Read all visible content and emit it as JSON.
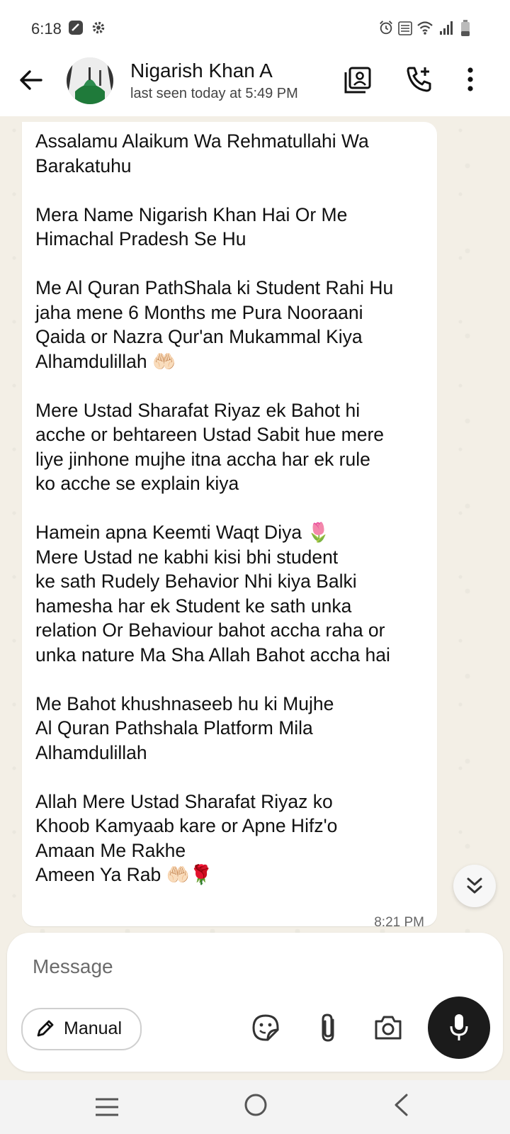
{
  "status_bar": {
    "time": "6:18"
  },
  "chat_header": {
    "contact_name": "Nigarish Khan A",
    "last_seen": "last seen today at 5:49 PM"
  },
  "message": {
    "text": "Assalamu Alaikum Wa Rehmatullahi Wa\nBarakatuhu\n\nMera Name Nigarish Khan Hai Or Me\nHimachal Pradesh Se Hu\n\nMe Al Quran PathShala ki Student Rahi Hu\njaha mene 6 Months me Pura Nooraani\nQaida or Nazra Qur'an Mukammal Kiya\nAlhamdulillah 🤲🏻\n\nMere Ustad Sharafat Riyaz ek Bahot hi\nacche or behtareen Ustad Sabit hue mere\nliye jinhone mujhe itna accha har ek rule\nko acche se explain kiya\n\nHamein apna Keemti Waqt Diya 🌷\nMere Ustad ne kabhi kisi bhi student\nke sath Rudely Behavior Nhi kiya Balki\nhamesha har ek Student ke sath unka\nrelation Or Behaviour bahot accha raha or\nunka nature Ma Sha Allah Bahot accha hai\n\nMe Bahot khushnaseeb hu ki Mujhe\nAl Quran Pathshala Platform Mila\nAlhamdulillah\n\nAllah Mere Ustad Sharafat Riyaz ko\nKhoob Kamyaab kare or Apne Hifz'o\nAmaan Me Rakhe\nAmeen Ya Rab 🤲🏻🌹",
    "time": "8:21 PM"
  },
  "composer": {
    "placeholder": "Message",
    "manual_label": "Manual"
  },
  "icons": {
    "back": "arrow-left-icon",
    "contact_card": "contact-card-icon",
    "add_call": "add-call-icon",
    "more": "more-vert-icon",
    "emoji_sticker": "sticker-icon",
    "attach": "paperclip-icon",
    "camera": "camera-icon",
    "mic": "mic-icon",
    "scroll_down": "double-chevron-down-icon"
  }
}
